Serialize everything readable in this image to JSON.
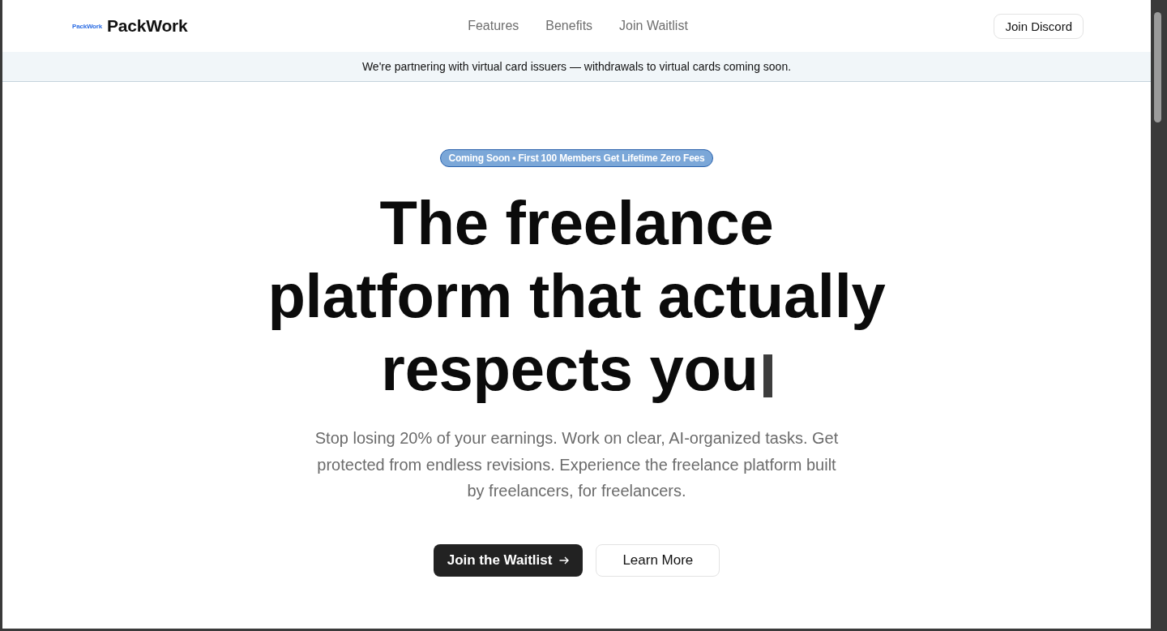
{
  "header": {
    "logo_mark": "PackWork",
    "brand": "PackWork",
    "nav": [
      "Features",
      "Benefits",
      "Join Waitlist"
    ],
    "action": "Join Discord"
  },
  "announcement": "We're partnering with virtual card issuers — withdrawals to virtual cards coming soon.",
  "hero": {
    "badge": "Coming Soon • First 100 Members Get Lifetime Zero Fees",
    "headline": "The freelance platform that actually respects you",
    "typing_cursor": true,
    "subtitle": "Stop losing 20% of your earnings. Work on clear, AI-organized tasks. Get protected from endless revisions. Experience the freelance platform built by freelancers, for freelancers.",
    "buttons": [
      {
        "kind": "primary",
        "label": "Join the Waitlist",
        "arrow": true
      },
      {
        "kind": "secondary",
        "label": "Learn More",
        "arrow": false
      }
    ]
  }
}
